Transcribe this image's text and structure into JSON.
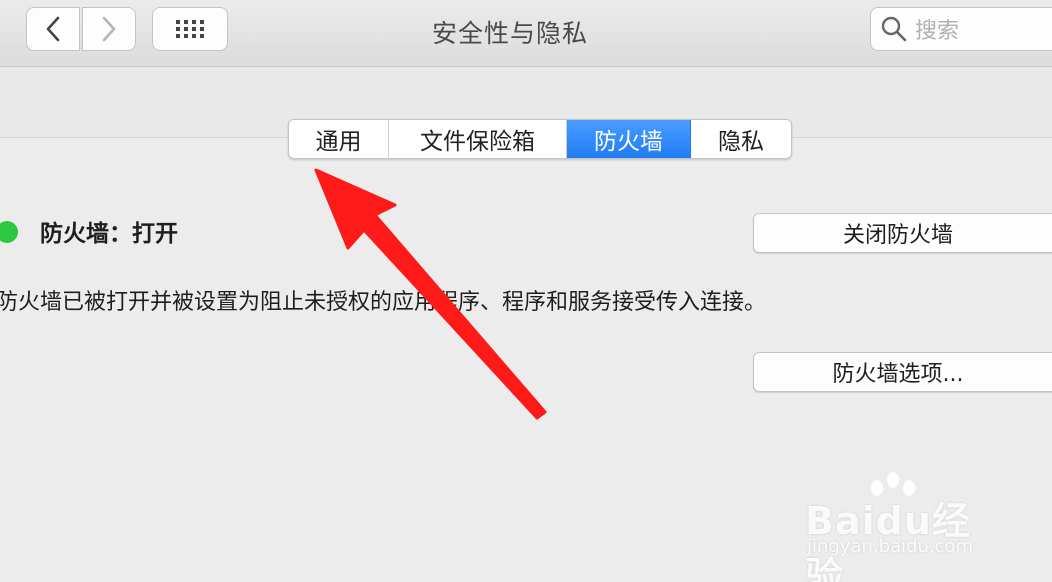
{
  "window": {
    "title": "安全性与隐私"
  },
  "toolbar": {
    "back_icon": "chevron-left-icon",
    "forward_icon": "chevron-right-icon",
    "grid_icon": "grid-icon",
    "search_placeholder": "搜索"
  },
  "tabs": [
    {
      "label": "通用",
      "active": false
    },
    {
      "label": "文件保险箱",
      "active": false
    },
    {
      "label": "防火墙",
      "active": true
    },
    {
      "label": "隐私",
      "active": false
    }
  ],
  "firewall": {
    "status_label": "防火墙：打开",
    "status_color": "#29c940",
    "description": "防火墙已被打开并被设置为阻止未授权的应用程序、程序和服务接受传入连接。",
    "turn_off_button": "关闭防火墙",
    "options_button": "防火墙选项..."
  },
  "colors": {
    "accent": "#1f7cf5",
    "annotation_arrow": "#ff1a1a"
  },
  "watermark": {
    "brand": "Baidu经验",
    "url": "jingyan.baidu.com"
  }
}
